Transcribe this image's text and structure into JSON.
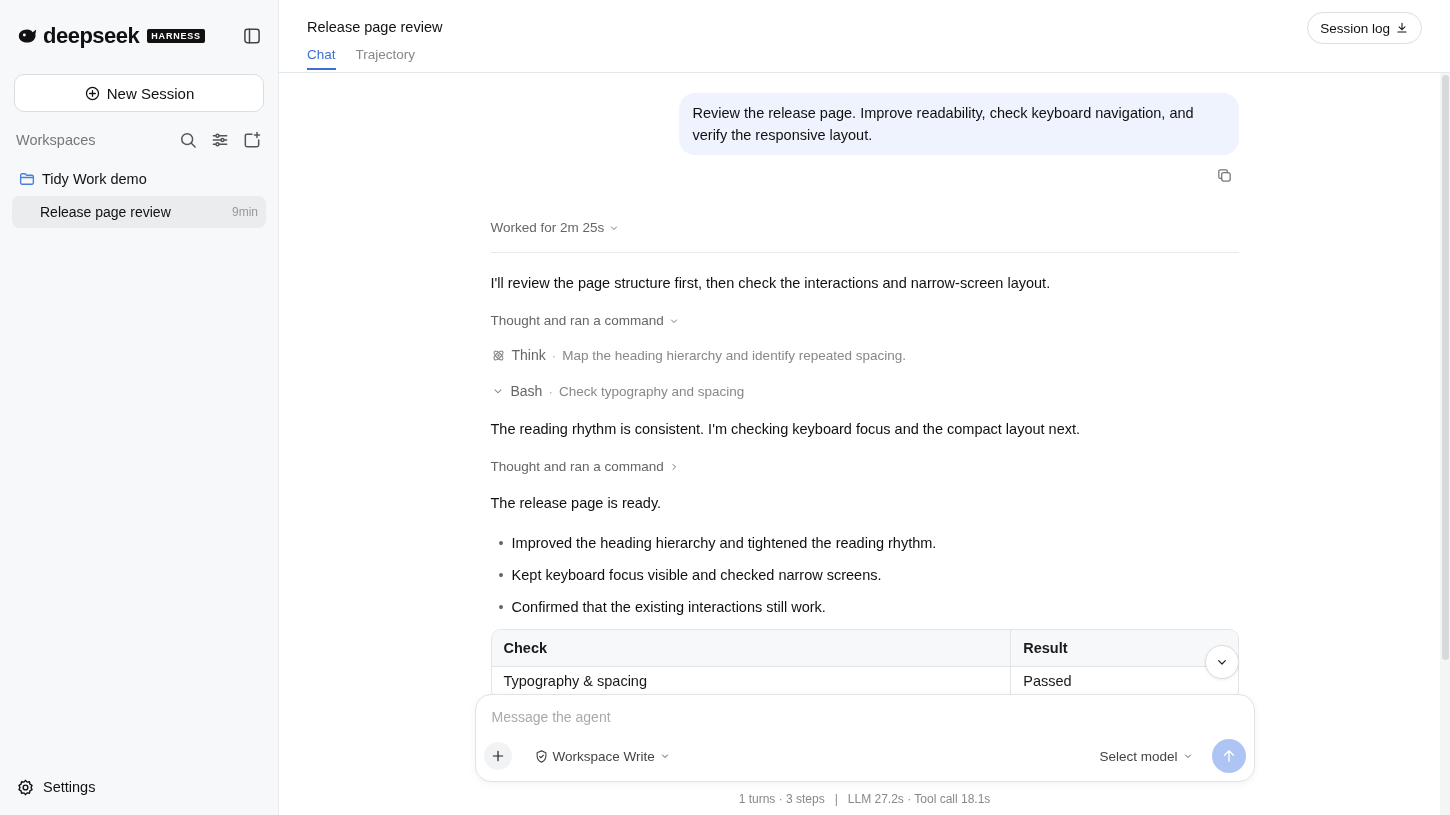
{
  "sidebar": {
    "brand": {
      "name": "deepseek",
      "badge": "HARNESS"
    },
    "new_session": "New Session",
    "workspaces_label": "Workspaces",
    "workspaces": [
      {
        "name": "Tidy Work demo",
        "sessions": [
          {
            "title": "Release page review",
            "time": "9min",
            "selected": true
          }
        ]
      }
    ],
    "settings": "Settings"
  },
  "header": {
    "title": "Release page review",
    "tabs": [
      {
        "label": "Chat",
        "selected": true
      },
      {
        "label": "Trajectory",
        "selected": false
      }
    ],
    "session_log": "Session log"
  },
  "chat": {
    "user_message": "Review the release page. Improve readability, check keyboard navigation, and verify the responsive layout.",
    "worked_for": {
      "label": "Worked for 2m 25s",
      "expanded": true
    },
    "blocks": [
      {
        "kind": "text",
        "text": "I'll review the page structure first, then check the interactions and narrow-screen layout."
      },
      {
        "kind": "group",
        "label": "Thought and ran a command",
        "expanded": true,
        "steps": [
          {
            "kind": "think",
            "name": "Think",
            "separator": "·",
            "detail": "Map the heading hierarchy and identify repeated spacing."
          },
          {
            "kind": "bash",
            "name": "Bash",
            "separator": "·",
            "detail": "Check typography and spacing"
          }
        ]
      },
      {
        "kind": "text",
        "text": "The reading rhythm is consistent. I'm checking keyboard focus and the compact layout next."
      },
      {
        "kind": "group",
        "label": "Thought and ran a command",
        "expanded": false
      },
      {
        "kind": "text",
        "text": "The release page is ready."
      },
      {
        "kind": "bullets",
        "marker": "•",
        "items": [
          "Improved the heading hierarchy and tightened the reading rhythm.",
          "Kept keyboard focus visible and checked narrow screens.",
          "Confirmed that the existing interactions still work."
        ]
      },
      {
        "kind": "table",
        "columns": [
          "Check",
          "Result"
        ],
        "rows": [
          [
            "Typography & spacing",
            "Passed"
          ]
        ]
      }
    ]
  },
  "composer": {
    "placeholder": "Message the agent",
    "permission": "Workspace Write",
    "model": "Select model"
  },
  "stats": {
    "steps": "1 turns · 3 steps",
    "separator": "|",
    "timing": "LLM 27.2s · Tool call 18.1s"
  }
}
